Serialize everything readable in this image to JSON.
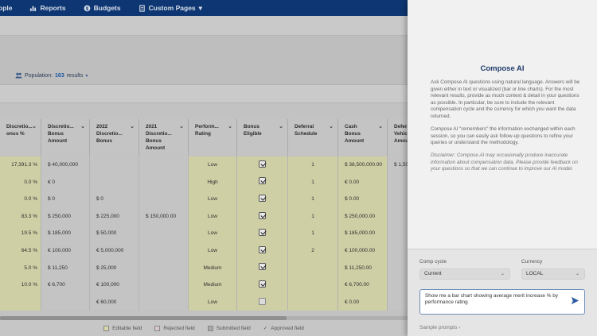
{
  "nav": {
    "items": [
      {
        "label": "ople",
        "icon": "people-icon"
      },
      {
        "label": "Reports",
        "icon": "reports-icon"
      },
      {
        "label": "Budgets",
        "icon": "budgets-icon"
      },
      {
        "label": "Custom Pages",
        "icon": "pages-icon",
        "caret": "▾"
      }
    ]
  },
  "population": {
    "label": "Population:",
    "count": "163",
    "suffix": "results",
    "caret": "▾"
  },
  "table": {
    "columns": [
      {
        "label": "Discretio...\nonus %"
      },
      {
        "label": "Discretio...\nBonus\nAmount"
      },
      {
        "label": "2022\nDiscretio...\nBonus"
      },
      {
        "label": "2021\nDiscretio...\nBonus\nAmount"
      },
      {
        "label": "Perform...\nRating"
      },
      {
        "label": "Bonus\nEligible"
      },
      {
        "label": "Deferral\nSchedule"
      },
      {
        "label": "Cash\nBonus\nAmount"
      },
      {
        "label": "Defer\nVehic\nAmou"
      }
    ],
    "chevron": "⌄",
    "rows": [
      {
        "pct": "17,391.3 %",
        "amount": "$ 40,000,000",
        "b2022": "",
        "b2021": "",
        "rating": "Low",
        "eligible": true,
        "deferral": "1",
        "cash": "$ 38,500,000.00",
        "vehicle": "$ 1,50"
      },
      {
        "pct": "0.0 %",
        "amount": "€ 0",
        "b2022": "",
        "b2021": "",
        "rating": "High",
        "eligible": true,
        "deferral": "1",
        "cash": "€ 0.00",
        "vehicle": ""
      },
      {
        "pct": "0.0 %",
        "amount": "$ 0",
        "b2022": "$ 0",
        "b2021": "",
        "rating": "Low",
        "eligible": true,
        "deferral": "1",
        "cash": "$ 0.00",
        "vehicle": ""
      },
      {
        "pct": "83.3 %",
        "amount": "$ 250,000",
        "b2022": "$ 225,000",
        "b2021": "$ 150,000.00",
        "rating": "Low",
        "eligible": true,
        "deferral": "1",
        "cash": "$ 250,000.00",
        "vehicle": ""
      },
      {
        "pct": "19.5 %",
        "amount": "$ 185,000",
        "b2022": "$ 50,000",
        "b2021": "",
        "rating": "Low",
        "eligible": true,
        "deferral": "1",
        "cash": "$ 185,000.00",
        "vehicle": ""
      },
      {
        "pct": "64.5 %",
        "amount": "€ 100,000",
        "b2022": "€ 5,000,000",
        "b2021": "",
        "rating": "Low",
        "eligible": true,
        "deferral": "2",
        "cash": "€ 100,000.00",
        "vehicle": ""
      },
      {
        "pct": "5.0 %",
        "amount": "$ 11,250",
        "b2022": "$ 25,000",
        "b2021": "",
        "rating": "Medium",
        "eligible": true,
        "deferral": "",
        "cash": "$ 11,250.00",
        "vehicle": ""
      },
      {
        "pct": "10.0 %",
        "amount": "€ 6,700",
        "b2022": "€ 100,000",
        "b2021": "",
        "rating": "Medium",
        "eligible": true,
        "deferral": "",
        "cash": "€ 6,700.00",
        "vehicle": ""
      },
      {
        "pct": "",
        "amount": "",
        "b2022": "€ 60,000",
        "b2021": "",
        "rating": "Low",
        "eligible": false,
        "deferral": "",
        "cash": "€ 0.00",
        "vehicle": ""
      }
    ]
  },
  "legend": [
    {
      "label": "Editable field",
      "color": "#d8d8a8"
    },
    {
      "label": "Rejected field",
      "color": "#d8c8c8"
    },
    {
      "label": "Submitted field",
      "color": "#a8a8a8"
    },
    {
      "label": "Approved field",
      "glyph": "✓"
    }
  ],
  "panel": {
    "title": "Compose AI",
    "intro": "Ask Compose AI questions using natural language. Answers will be given either in text or visualized (bar or line charts). For the most relevant results, provide as much context & detail in your questions as possible. In particular, be sure to include the relevant compensation cycle and the currency for which you want the data returned.",
    "memory": "Compose AI \"remembers\" the information exchanged within each session, so you can easily ask follow-up questions to refine your queries or understand the methodology.",
    "disclaimer": "Disclaimer: Compose AI may occasionally produce inaccurate information about compensation data. Please provide feedback on your questions so that we can continue to improve our AI model.",
    "comp_cycle": {
      "label": "Comp cycle",
      "value": "Current"
    },
    "currency": {
      "label": "Currency",
      "value": "LOCAL"
    },
    "prompt_value": "Show me a bar chart showing average merit increase % by performance rating",
    "sample_prompts": "Sample prompts ›"
  },
  "colors": {
    "nav": "#0d3672",
    "accent": "#1f56a3"
  }
}
